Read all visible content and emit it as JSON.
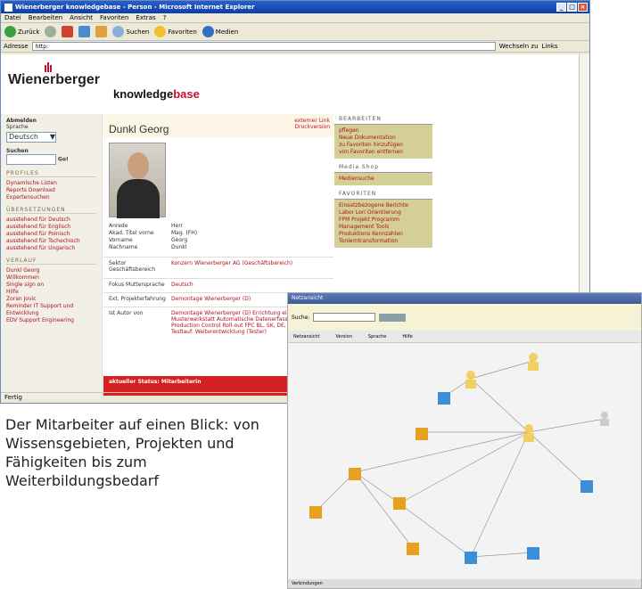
{
  "browser": {
    "title": "Wienerberger knowledgebase - Person - Microsoft Internet Explorer",
    "menu": [
      "Datei",
      "Bearbeiten",
      "Ansicht",
      "Favoriten",
      "Extras",
      "?"
    ],
    "toolbar": {
      "back": "Zurück",
      "search": "Suchen",
      "favorites": "Favoriten",
      "media": "Medien"
    },
    "address_label": "Adresse",
    "address_value": "http:",
    "go_label": "Wechseln zu",
    "links_label": "Links",
    "status": "Fertig"
  },
  "site": {
    "brand": "Wienerberger",
    "kb_prefix": "knowledge",
    "kb_suffix": "base"
  },
  "leftnav": {
    "lang_heading": "Abmelden",
    "lang_label": "Sprache",
    "lang_value": "Deutsch",
    "search_label": "Suchen",
    "search_go": "Go!",
    "sec1": "PROFILES",
    "sec1_items": [
      "Dynamische Listen",
      "Reports Download",
      "Expertensuchen"
    ],
    "sec2": "ÜBERSETZUNGEN",
    "sec2_items": [
      "ausstehend für Deutsch",
      "ausstehend für Englisch",
      "ausstehend für Polnisch",
      "ausstehend für Tschechisch",
      "ausstehend für Ungarisch"
    ],
    "sec3": "VERLAUF",
    "sec3_items": [
      "Dunkl Georg",
      "Willkommen",
      "Single sign on",
      "Hilfe",
      "Zoran Jovic",
      "Reminder IT Support und Entwicklung",
      "EDV Support Engineering"
    ]
  },
  "person": {
    "name": "Dunkl Georg",
    "ext_link": "externer Link",
    "print": "Druckversion",
    "fields": [
      {
        "k": "Anrede",
        "v": "Herr"
      },
      {
        "k": "Akad. Titel vorne",
        "v": "Mag. (FH)"
      },
      {
        "k": "Vorname",
        "v": "Georg"
      },
      {
        "k": "Nachname",
        "v": "Dunkl"
      }
    ],
    "rows": [
      {
        "k": "Sektor Geschäftsbereich",
        "v": "Konzern Wienerberger AG (Geschäftsbereich)"
      },
      {
        "k": "Fokus Muttersprache",
        "v": "Deutsch"
      },
      {
        "k": "Ext. Projekterfahrung",
        "v": "Demontage Wienerberger (D)"
      },
      {
        "k": "Ist Autor von",
        "v": "Demontage Wienerberger (D) Errichtung einer Musterwerkstatt Automatische Datenerfassung Factory Production Control Roll-out FPC BL, SK, DE, POR, FI Testlauf: Weiterentwicklung (Tester)"
      }
    ],
    "status_label": "aktueller Status: Mitarbeiterin"
  },
  "rightnav": {
    "edit_heading": "BEARBEITEN",
    "edit_items": [
      "pflegen",
      "Neue Dokumentation",
      "zu Favoriten hinzufügen",
      "von Favoriten entfernen"
    ],
    "media_heading": "Media Shop",
    "media_items": [
      "Mediensuche"
    ],
    "fav_heading": "FAVORITEN",
    "fav_items": [
      "Einsatzbezogene Berichte",
      "Labor Lori Orientierung",
      "FPM Projekt Programm Management Tools",
      "Produktions Kennzahlen",
      "Tonlerntransformation"
    ]
  },
  "caption": "Der Mitarbeiter auf einen Blick: von Wissensgebieten, Projekten und Fähigkeiten bis zum Weiterbildungsbedarf",
  "graph": {
    "title": "Netzansicht",
    "search_label": "Suche:",
    "tabs": [
      "Netzansicht",
      "Version",
      "Sprache",
      "Hilfe"
    ],
    "status": "Verbindungen",
    "colors": {
      "cube_blue": "#3a8fd8",
      "cube_orange": "#e8a020",
      "person_yellow": "#f0d060"
    }
  }
}
